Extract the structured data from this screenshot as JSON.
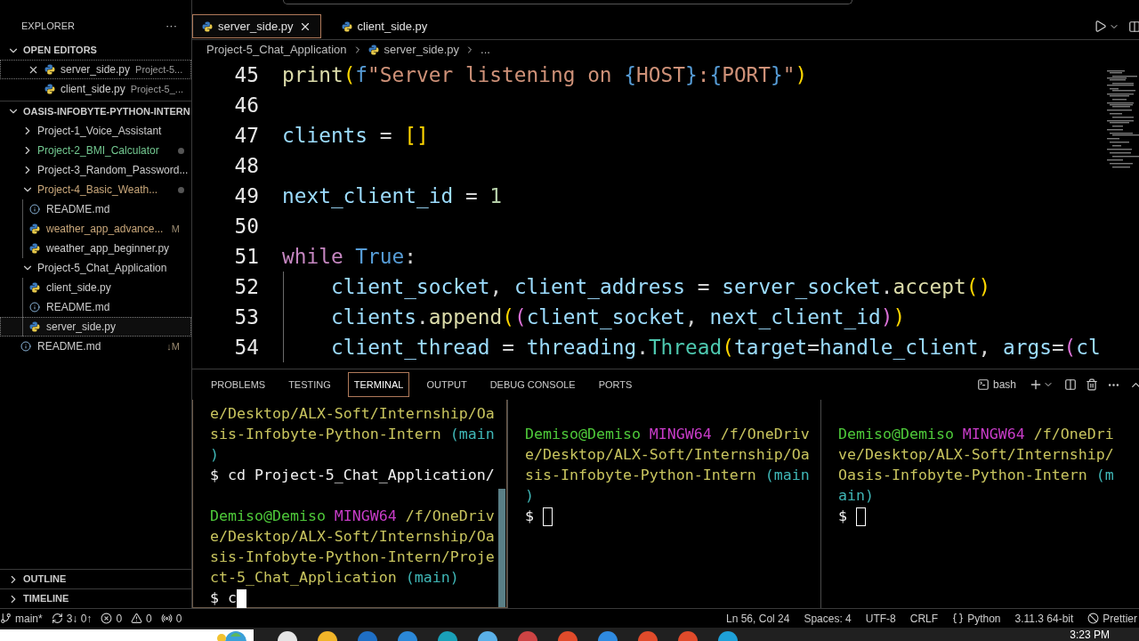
{
  "sidebar": {
    "title": "EXPLORER",
    "more": "···",
    "open_editors": {
      "title": "OPEN EDITORS",
      "expanded": true,
      "items": [
        {
          "name": "server_side.py",
          "description": "Project-5...",
          "selected": true
        },
        {
          "name": "client_side.py",
          "description": "Project-5_...",
          "selected": false
        }
      ]
    },
    "workspace": {
      "title": "OASIS-INFOBYTE-PYTHON-INTERN",
      "expanded": true,
      "items": [
        {
          "kind": "folder",
          "name": "Project-1_Voice_Assistant",
          "expanded": false
        },
        {
          "kind": "folder",
          "name": "Project-2_BMI_Calculator",
          "expanded": false,
          "color": "#73c991"
        },
        {
          "kind": "folder",
          "name": "Project-3_Random_Password...",
          "expanded": false
        },
        {
          "kind": "folder",
          "name": "Project-4_Basic_Weath...",
          "expanded": true,
          "color": "#c9a77a",
          "children": [
            {
              "kind": "markdown",
              "name": "README.md",
              "selected": false
            },
            {
              "kind": "python",
              "name": "weather_app_advance...",
              "color": "#c9a77a",
              "badge": "M",
              "selected": false
            },
            {
              "kind": "python",
              "name": "weather_app_beginner.py",
              "selected": false
            }
          ]
        },
        {
          "kind": "folder",
          "name": "Project-5_Chat_Application",
          "expanded": true,
          "children": [
            {
              "kind": "python",
              "name": "client_side.py",
              "selected": false
            },
            {
              "kind": "markdown",
              "name": "README.md",
              "selected": false
            },
            {
              "kind": "python",
              "name": "server_side.py",
              "selected": true
            }
          ]
        },
        {
          "kind": "markdown",
          "name": "README.md",
          "badge": "↓M",
          "selected": false
        }
      ]
    },
    "sections": [
      {
        "title": "OUTLINE",
        "expanded": false
      },
      {
        "title": "TIMELINE",
        "expanded": false
      }
    ]
  },
  "editor": {
    "tabs": [
      {
        "label": "server_side.py",
        "selected": true
      },
      {
        "label": "client_side.py",
        "selected": false
      }
    ],
    "breadcrumb": [
      "Project-5_Chat_Application",
      "server_side.py",
      "..."
    ],
    "lines": [
      {
        "number": "45",
        "indent": false,
        "tokens": [
          {
            "kind": "fn",
            "text": "print"
          },
          {
            "kind": "br1",
            "text": "("
          },
          {
            "kind": "kw",
            "text": "f"
          },
          {
            "kind": "str",
            "text": "\"Server listening on "
          },
          {
            "kind": "kw",
            "text": "{"
          },
          {
            "kind": "str",
            "text": "HOST"
          },
          {
            "kind": "kw",
            "text": "}"
          },
          {
            "kind": "str",
            "text": ":"
          },
          {
            "kind": "kw",
            "text": "{"
          },
          {
            "kind": "str",
            "text": "PORT"
          },
          {
            "kind": "kw",
            "text": "}"
          },
          {
            "kind": "str",
            "text": "\""
          },
          {
            "kind": "br1",
            "text": ")"
          }
        ]
      },
      {
        "number": "46",
        "indent": false
      },
      {
        "number": "47",
        "indent": false,
        "tokens": [
          {
            "kind": "var",
            "text": "clients"
          },
          {
            "kind": "op",
            "text": " = "
          },
          {
            "kind": "br1",
            "text": "[]"
          }
        ]
      },
      {
        "number": "48",
        "indent": false
      },
      {
        "number": "49",
        "indent": false,
        "tokens": [
          {
            "kind": "var",
            "text": "next_client_id"
          },
          {
            "kind": "op",
            "text": " = "
          },
          {
            "kind": "num",
            "text": "1"
          }
        ]
      },
      {
        "number": "50",
        "indent": false
      },
      {
        "number": "51",
        "indent": false,
        "tokens": [
          {
            "kind": "ctl",
            "text": "while "
          },
          {
            "kind": "kw",
            "text": "True"
          },
          {
            "kind": "op",
            "text": ":"
          }
        ]
      },
      {
        "number": "52",
        "indent": true,
        "tokens": [
          {
            "kind": "var",
            "text": "client_socket"
          },
          {
            "kind": "op",
            "text": ", "
          },
          {
            "kind": "var",
            "text": "client_address"
          },
          {
            "kind": "op",
            "text": " = "
          },
          {
            "kind": "var",
            "text": "server_socket"
          },
          {
            "kind": "op",
            "text": "."
          },
          {
            "kind": "fn",
            "text": "accept"
          },
          {
            "kind": "br1",
            "text": "()"
          }
        ]
      },
      {
        "number": "53",
        "indent": true,
        "tokens": [
          {
            "kind": "var",
            "text": "clients"
          },
          {
            "kind": "op",
            "text": "."
          },
          {
            "kind": "fn",
            "text": "append"
          },
          {
            "kind": "br1",
            "text": "("
          },
          {
            "kind": "br2",
            "text": "("
          },
          {
            "kind": "var",
            "text": "client_socket"
          },
          {
            "kind": "op",
            "text": ", "
          },
          {
            "kind": "var",
            "text": "next_client_id"
          },
          {
            "kind": "br2",
            "text": ")"
          },
          {
            "kind": "br1",
            "text": ")"
          }
        ]
      },
      {
        "number": "54",
        "indent": true,
        "tokens": [
          {
            "kind": "var",
            "text": "client_thread"
          },
          {
            "kind": "op",
            "text": " = "
          },
          {
            "kind": "var",
            "text": "threading"
          },
          {
            "kind": "op",
            "text": "."
          },
          {
            "kind": "cls",
            "text": "Thread"
          },
          {
            "kind": "br1",
            "text": "("
          },
          {
            "kind": "var",
            "text": "target"
          },
          {
            "kind": "op",
            "text": "="
          },
          {
            "kind": "var",
            "text": "handle_client"
          },
          {
            "kind": "op",
            "text": ", "
          },
          {
            "kind": "var",
            "text": "args"
          },
          {
            "kind": "op",
            "text": "="
          },
          {
            "kind": "br2",
            "text": "("
          },
          {
            "kind": "var",
            "text": "cl"
          }
        ]
      }
    ]
  },
  "panel": {
    "tabs": [
      {
        "label": "PROBLEMS",
        "selected": false
      },
      {
        "label": "TESTING",
        "selected": false
      },
      {
        "label": "TERMINAL",
        "selected": true
      },
      {
        "label": "OUTPUT",
        "selected": false
      },
      {
        "label": "DEBUG CONSOLE",
        "selected": false
      },
      {
        "label": "PORTS",
        "selected": false
      }
    ],
    "shell": "bash",
    "terminals": [
      {
        "focused": true,
        "lines": [
          {
            "spaced": false,
            "segments": [
              {
                "kind": "path",
                "text": "e/Desktop/ALX-Soft/Internship/Oa"
              }
            ]
          },
          {
            "spaced": false,
            "segments": [
              {
                "kind": "path",
                "text": "sis-Infobyte-Python-Intern "
              },
              {
                "kind": "branch",
                "text": "(main"
              }
            ]
          },
          {
            "spaced": false,
            "segments": [
              {
                "kind": "branch",
                "text": ")"
              }
            ]
          },
          {
            "spaced": false,
            "segments": [
              {
                "kind": "plain",
                "text": "$ cd Project-5_Chat_Application/"
              }
            ]
          },
          {
            "spaced": true,
            "segments": [
              {
                "kind": "user",
                "text": "Demiso@Demiso"
              },
              {
                "kind": "host",
                "text": " MINGW64"
              },
              {
                "kind": "path",
                "text": " /f/OneDriv"
              }
            ]
          },
          {
            "spaced": false,
            "segments": [
              {
                "kind": "path",
                "text": "e/Desktop/ALX-Soft/Internship/Oa"
              }
            ]
          },
          {
            "spaced": false,
            "segments": [
              {
                "kind": "path",
                "text": "sis-Infobyte-Python-Intern/Proje"
              }
            ]
          },
          {
            "spaced": false,
            "segments": [
              {
                "kind": "path",
                "text": "ct-5_Chat_Application"
              },
              {
                "kind": "branch",
                "text": " (main)"
              }
            ]
          },
          {
            "spaced": false,
            "segments": [
              {
                "kind": "plain",
                "text": "$ c"
              },
              {
                "kind": "cursor"
              }
            ]
          }
        ]
      },
      {
        "focused": false,
        "lines": [
          {
            "spaced": true,
            "segments": [
              {
                "kind": "user",
                "text": "Demiso@Demiso"
              },
              {
                "kind": "host",
                "text": " MINGW64"
              },
              {
                "kind": "path",
                "text": " /f/OneDriv"
              }
            ]
          },
          {
            "spaced": false,
            "segments": [
              {
                "kind": "path",
                "text": "e/Desktop/ALX-Soft/Internship/Oa"
              }
            ]
          },
          {
            "spaced": false,
            "segments": [
              {
                "kind": "path",
                "text": "sis-Infobyte-Python-Intern "
              },
              {
                "kind": "branch",
                "text": "(main"
              }
            ]
          },
          {
            "spaced": false,
            "segments": [
              {
                "kind": "branch",
                "text": ")"
              }
            ]
          },
          {
            "spaced": false,
            "segments": [
              {
                "kind": "plain",
                "text": "$ "
              },
              {
                "kind": "cursor"
              }
            ]
          }
        ]
      },
      {
        "focused": false,
        "lines": [
          {
            "spaced": true,
            "segments": [
              {
                "kind": "user",
                "text": "Demiso@Demiso"
              },
              {
                "kind": "host",
                "text": " MINGW64"
              },
              {
                "kind": "path",
                "text": " /f/OneDri"
              }
            ]
          },
          {
            "spaced": false,
            "segments": [
              {
                "kind": "path",
                "text": "ve/Desktop/ALX-Soft/Internship/"
              }
            ]
          },
          {
            "spaced": false,
            "segments": [
              {
                "kind": "path",
                "text": "Oasis-Infobyte-Python-Intern "
              },
              {
                "kind": "branch",
                "text": "(m"
              }
            ]
          },
          {
            "spaced": false,
            "segments": [
              {
                "kind": "branch",
                "text": "ain)"
              }
            ]
          },
          {
            "spaced": false,
            "segments": [
              {
                "kind": "plain",
                "text": "$ "
              },
              {
                "kind": "cursor"
              }
            ]
          }
        ]
      }
    ]
  },
  "status_bar": {
    "left": [
      {
        "kind": "branch",
        "text": "main*"
      },
      {
        "kind": "sync",
        "text": "3↓ 0↑"
      },
      {
        "kind": "errors",
        "text": "0"
      },
      {
        "kind": "warnings",
        "text": "0"
      },
      {
        "kind": "ports",
        "text": "0"
      }
    ],
    "right": [
      {
        "kind": "text",
        "text": "Ln 56, Col 24"
      },
      {
        "kind": "text",
        "text": "Spaces: 4"
      },
      {
        "kind": "text",
        "text": "UTF-8"
      },
      {
        "kind": "text",
        "text": "CRLF"
      },
      {
        "kind": "language",
        "text": "Python"
      },
      {
        "kind": "text",
        "text": "3.11.3 64-bit"
      },
      {
        "kind": "prettier",
        "text": "Prettier"
      }
    ]
  },
  "taskbar": {
    "time": "3:23 PM"
  }
}
